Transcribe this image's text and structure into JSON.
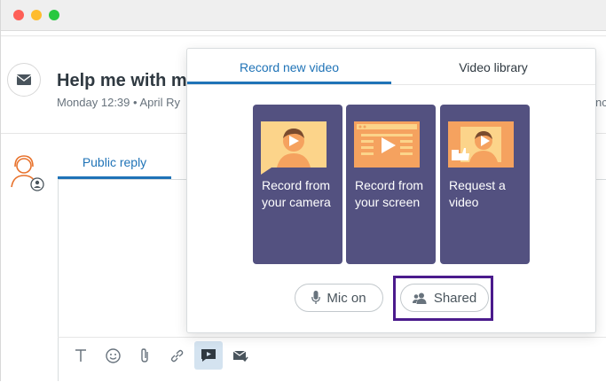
{
  "ticket": {
    "title": "Help me with my",
    "meta": "Monday 12:39 • April Ry",
    "meta_right": "nc"
  },
  "reply": {
    "tab_label": "Public reply"
  },
  "video_popover": {
    "tabs": [
      {
        "label": "Record new video",
        "active": true
      },
      {
        "label": "Video library",
        "active": false
      }
    ],
    "cards": [
      {
        "label": "Record from your camera",
        "icon": "camera-person-icon"
      },
      {
        "label": "Record from your screen",
        "icon": "screen-play-icon"
      },
      {
        "label": "Request a video",
        "icon": "video-request-icon"
      }
    ],
    "mic_label": "Mic on",
    "shared_label": "Shared"
  },
  "toolbar": {
    "icons": [
      "text-format-icon",
      "emoji-icon",
      "attachment-icon",
      "link-icon",
      "video-icon",
      "email-icon"
    ]
  },
  "colors": {
    "accent": "#1f73b7",
    "card": "#535180",
    "highlight": "#4b1b8c"
  }
}
